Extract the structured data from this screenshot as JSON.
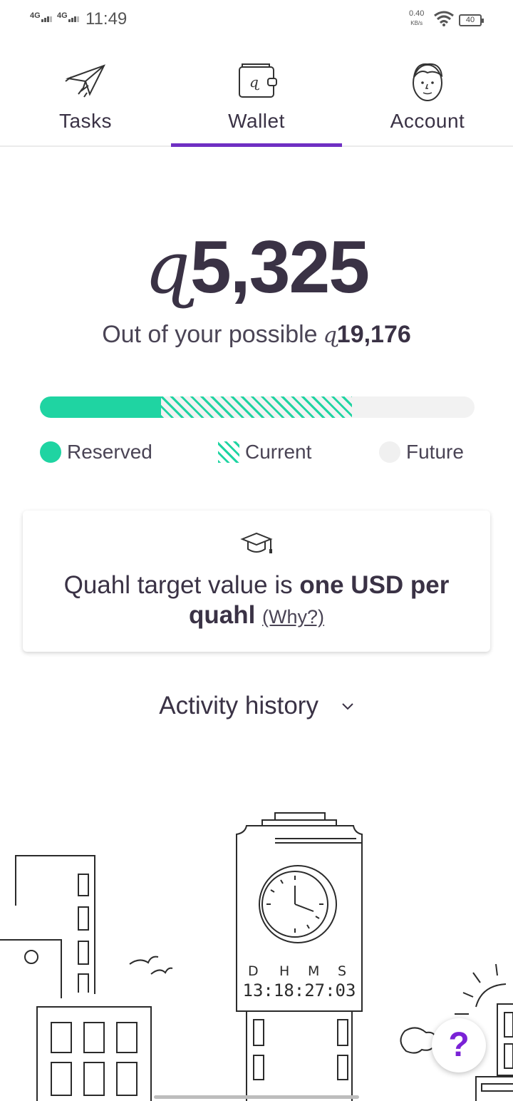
{
  "status_bar": {
    "signal1": "4G",
    "signal2": "4G",
    "time": "11:49",
    "speed": "0.40",
    "speed_unit": "KB/s",
    "battery": "40"
  },
  "tabs": [
    {
      "label": "Tasks",
      "icon": "paper-plane-icon",
      "active": false
    },
    {
      "label": "Wallet",
      "icon": "wallet-icon",
      "active": true
    },
    {
      "label": "Account",
      "icon": "face-icon",
      "active": false
    }
  ],
  "wallet": {
    "currency_symbol": "ɋ",
    "balance": "5,325",
    "possible_prefix": "Out of your possible",
    "possible_value": "19,176"
  },
  "progress": {
    "reserved_fraction": 0.2787,
    "current_fraction": 0.4393,
    "colors": {
      "reserved": "#1fd4a2",
      "future": "#f2f2f2"
    }
  },
  "legend": {
    "reserved": "Reserved",
    "current": "Current",
    "future": "Future"
  },
  "info_card": {
    "text_prefix": "Quahl target value is ",
    "text_bold": "one USD per quahl",
    "why_link": "(Why?)"
  },
  "activity": {
    "label": "Activity history"
  },
  "clock_tower": {
    "labels": [
      "D",
      "H",
      "M",
      "S"
    ],
    "countdown": "13:18:27:03"
  },
  "help": {
    "label": "?"
  },
  "accent_color": "#6f2fc3"
}
